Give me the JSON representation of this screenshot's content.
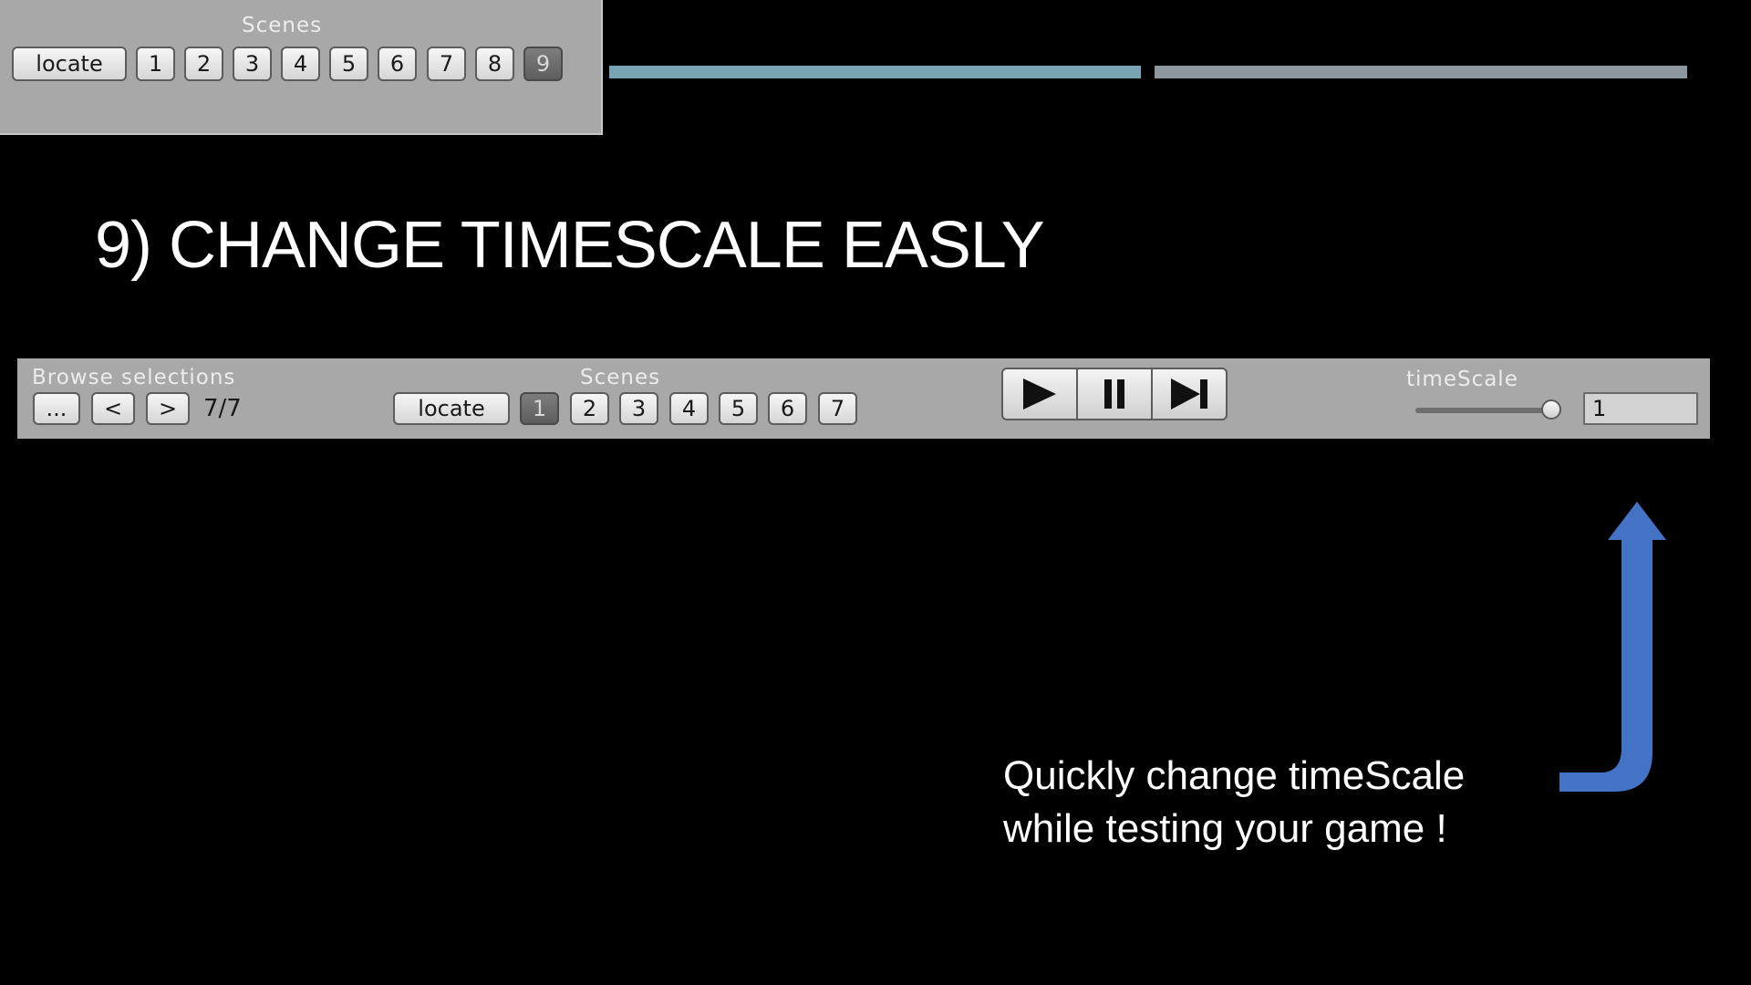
{
  "top_panel": {
    "label": "Scenes",
    "locate_label": "locate",
    "scene_buttons": [
      "1",
      "2",
      "3",
      "4",
      "5",
      "6",
      "7",
      "8",
      "9"
    ],
    "active_scene": "9"
  },
  "progress_bars": {
    "left_color": "#78a4b4",
    "right_color": "#8e979e"
  },
  "title": "9) CHANGE TIMESCALE EASLY",
  "toolbar": {
    "browse_label": "Browse selections",
    "more_button": "...",
    "prev_button": "<",
    "next_button": ">",
    "counter": "7/7",
    "scenes_label": "Scenes",
    "locate_label": "locate",
    "scene_buttons": [
      "1",
      "2",
      "3",
      "4",
      "5",
      "6",
      "7"
    ],
    "active_scene": "1",
    "play_icons": [
      "play-icon",
      "pause-icon",
      "step-icon"
    ],
    "timescale_label": "timeScale",
    "timescale_value": "1",
    "slider_level": 1.0
  },
  "caption": {
    "line1": "Quickly change timeScale",
    "line2": "while testing your game !"
  },
  "arrow_color": "#4472c4"
}
